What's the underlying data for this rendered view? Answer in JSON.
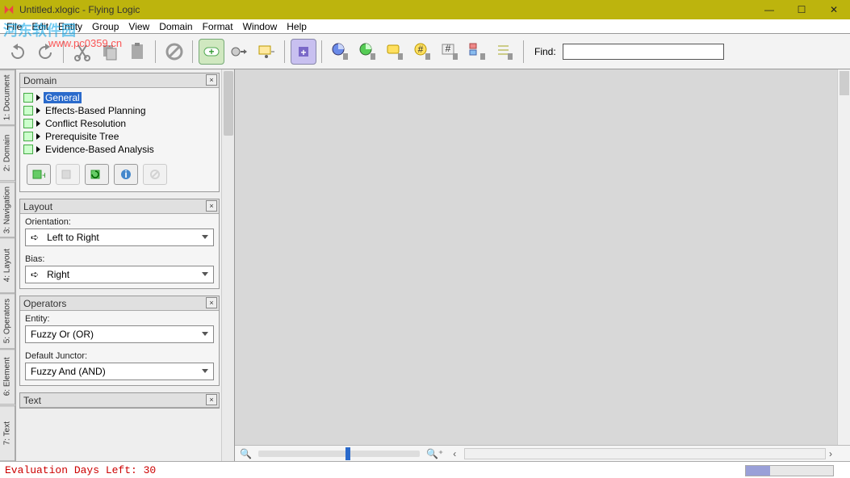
{
  "window": {
    "title": "Untitled.xlogic - Flying Logic",
    "controls": {
      "min": "—",
      "max": "☐",
      "close": "✕"
    }
  },
  "watermark": {
    "main": "河东软件园",
    "sub": "www.pc0359.cn"
  },
  "menu": [
    "File",
    "Edit",
    "Entity",
    "Group",
    "View",
    "Domain",
    "Format",
    "Window",
    "Help"
  ],
  "toolbar": {
    "undo": "undo",
    "redo": "redo",
    "cut": "cut",
    "copy": "copy",
    "paste": "paste",
    "block": "block",
    "add": "add",
    "add_node": "add-node",
    "add_group": "add-group",
    "collapse": "collapse",
    "blue": "blue-circle",
    "green": "green-circle",
    "yellow": "yellow-tag",
    "hash1": "hash1",
    "hash2": "hash2",
    "multi": "multi",
    "layout": "layout",
    "find_label": "Find:"
  },
  "vtabs": [
    "1: Document",
    "2: Domain",
    "3: Navigation",
    "4: Layout",
    "5: Operators",
    "6: Element",
    "7: Text"
  ],
  "sidebar": {
    "domain": {
      "title": "Domain",
      "items": [
        {
          "name": "General",
          "selected": true
        },
        {
          "name": "Effects-Based Planning",
          "selected": false
        },
        {
          "name": "Conflict Resolution",
          "selected": false
        },
        {
          "name": "Prerequisite Tree",
          "selected": false
        },
        {
          "name": "Evidence-Based Analysis",
          "selected": false
        }
      ],
      "buttons": [
        "new-domain",
        "link-domain",
        "refresh-domain",
        "info-domain",
        "block-domain"
      ]
    },
    "layout": {
      "title": "Layout",
      "orientation_label": "Orientation:",
      "orientation_value": "Left to Right",
      "bias_label": "Bias:",
      "bias_value": "Right"
    },
    "operators": {
      "title": "Operators",
      "entity_label": "Entity:",
      "entity_value": "Fuzzy Or (OR)",
      "junctor_label": "Default Junctor:",
      "junctor_value": "Fuzzy And (AND)"
    },
    "text": {
      "title": "Text"
    }
  },
  "statusbar": {
    "eval": "Evaluation Days Left: 30"
  },
  "footer": {
    "zoom_out": "🔍−",
    "zoom_in": "🔍+",
    "scroll_left": "‹",
    "scroll_right": "›"
  }
}
